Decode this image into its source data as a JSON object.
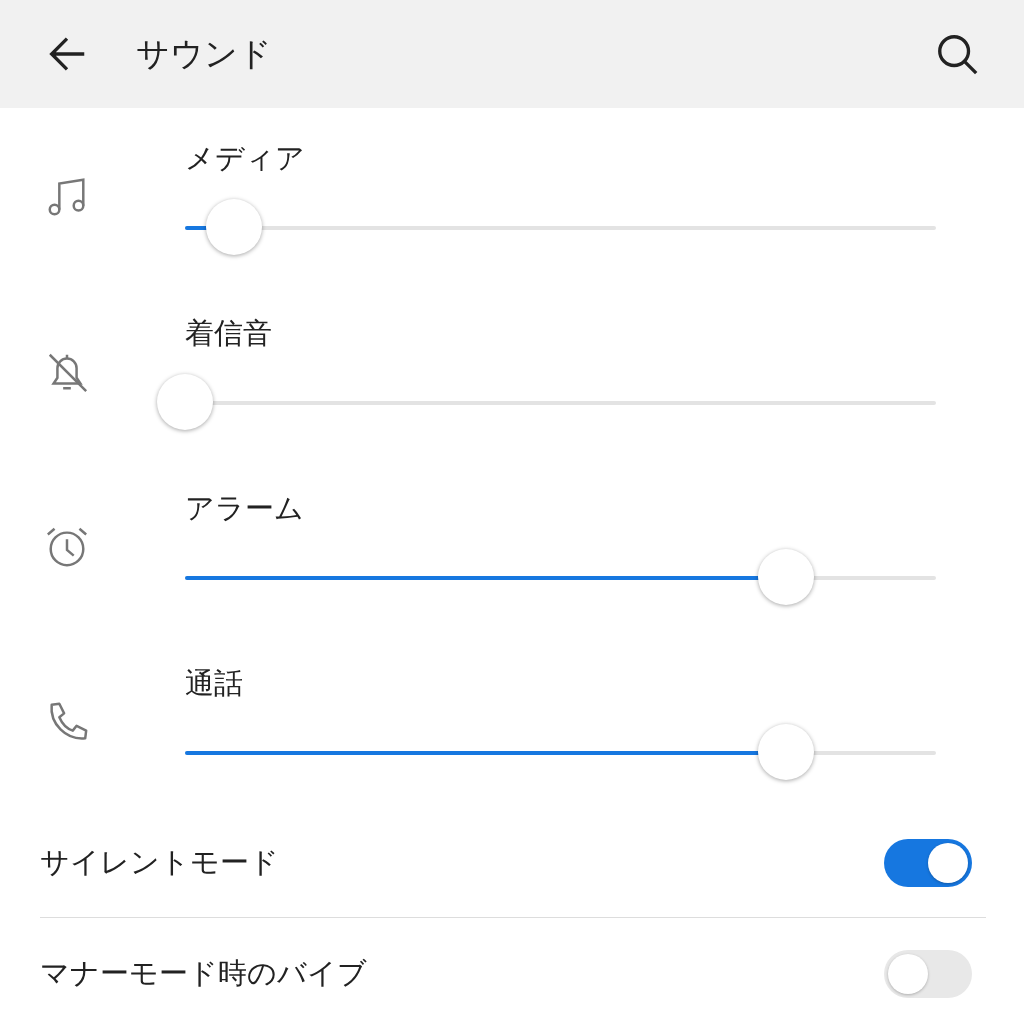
{
  "header": {
    "title": "サウンド"
  },
  "volumes": [
    {
      "kind": "music",
      "label": "メディア",
      "level": 0.065
    },
    {
      "kind": "bell-off",
      "label": "着信音",
      "level": 0
    },
    {
      "kind": "alarm",
      "label": "アラーム",
      "level": 0.8
    },
    {
      "kind": "phone",
      "label": "通話",
      "level": 0.8
    }
  ],
  "toggles": [
    {
      "label": "サイレントモード",
      "on": true
    },
    {
      "label": "マナーモード時のバイブ",
      "on": false
    }
  ]
}
